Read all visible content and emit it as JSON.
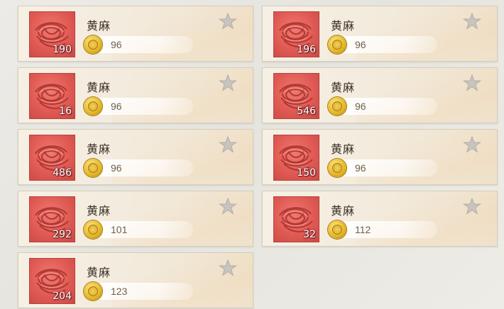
{
  "items": [
    {
      "name": "黄麻",
      "quantity": "190",
      "price": "96",
      "icon": "jute-bundle-icon"
    },
    {
      "name": "黄麻",
      "quantity": "196",
      "price": "96",
      "icon": "jute-bundle-icon"
    },
    {
      "name": "黄麻",
      "quantity": "16",
      "price": "96",
      "icon": "jute-bundle-icon"
    },
    {
      "name": "黄麻",
      "quantity": "546",
      "price": "96",
      "icon": "jute-bundle-icon"
    },
    {
      "name": "黄麻",
      "quantity": "486",
      "price": "96",
      "icon": "jute-bundle-icon"
    },
    {
      "name": "黄麻",
      "quantity": "150",
      "price": "96",
      "icon": "jute-bundle-icon"
    },
    {
      "name": "黄麻",
      "quantity": "292",
      "price": "101",
      "icon": "jute-bundle-icon"
    },
    {
      "name": "黄麻",
      "quantity": "32",
      "price": "112",
      "icon": "jute-bundle-icon"
    },
    {
      "name": "黄麻",
      "quantity": "204",
      "price": "123",
      "icon": "jute-bundle-icon"
    }
  ],
  "icons": {
    "currency": "gold-coin-icon",
    "favorite": "star-icon"
  },
  "colors": {
    "item_bg": "#e05a54",
    "card_bg": "#f4ede1",
    "star": "#b8b8b8",
    "coin": "#e7b92c"
  }
}
